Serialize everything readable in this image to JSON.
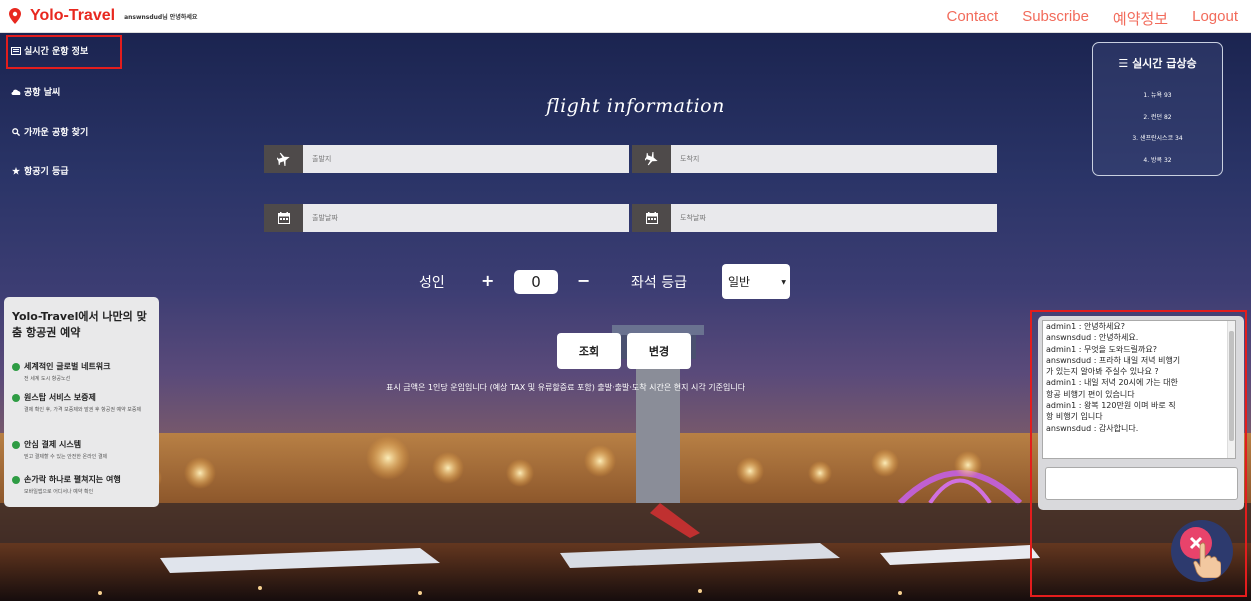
{
  "header": {
    "brand": "Yolo-Travel",
    "greeting": "answnsdud님 안녕하세요",
    "nav": [
      "Contact",
      "Subscribe",
      "예약정보",
      "Logout"
    ]
  },
  "sidebar": {
    "items": [
      "실시간 운항 정보",
      "공항 날씨",
      "가까운 공항 찾기",
      "항공기 등급"
    ]
  },
  "search": {
    "title": "flight information",
    "departure_placeholder": "출발지",
    "arrival_placeholder": "도착지",
    "departure_date_placeholder": "출발날짜",
    "arrival_date_placeholder": "도착날짜",
    "adult_label": "성인",
    "plus": "+",
    "minus": "−",
    "adult_count": "0",
    "seat_label": "좌석 등급",
    "seat_value": "일반",
    "search_button": "조회",
    "change_button": "변경",
    "notice": "표시 금액은 1인당 운임입니다 (예상 TAX 및 유류할증료 포함) 출발·출발·도착 시간은 현지 시각 기준입니다"
  },
  "trending": {
    "title": "실시간 급상승",
    "items": [
      "1. 뉴욕 93",
      "2. 런던 82",
      "3. 샌프란시스코 34",
      "4. 방콕 32"
    ]
  },
  "promo": {
    "title": "Yolo-Travel에서 나만의 맞춤 항공권 예약",
    "items": [
      {
        "head": "세계적인 글로벌 네트워크",
        "sub": "전 세계 도시 항공노선"
      },
      {
        "head": "원스탑 서비스 보증제",
        "sub": "결제 확인 후, 가격 보증제와 발권 후 항공권 예약 보증제"
      },
      {
        "head": "안심 결제 시스템",
        "sub": "믿고 결제할 수 있는 안전한 온라인 결제"
      },
      {
        "head": "손가락 하나로 펼쳐지는 여행",
        "sub": "모바일앱으로 어디서나 예약 확인"
      }
    ]
  },
  "chat": {
    "lines": [
      "admin1 : 안녕하세요?",
      "answnsdud : 안녕하세요.",
      "admin1 : 무엇을 도와드릴까요?",
      "answnsdud : 프라하 내일 저녁 비행기",
      "가 있는지 알아봐 주실수 있나요 ?",
      "admin1 : 내일 저녁 20시에 가는 대한",
      "항공 비행기 편이 있습니다",
      "admin1 : 왕복 120만원 이며 바로 직",
      "항 비행기 입니다",
      "answnsdud : 감사합니다."
    ]
  },
  "colors": {
    "brand": "#e8281f",
    "nav": "#f26b5b",
    "highlight": "#e31d1d",
    "check": "#2e9c44"
  }
}
